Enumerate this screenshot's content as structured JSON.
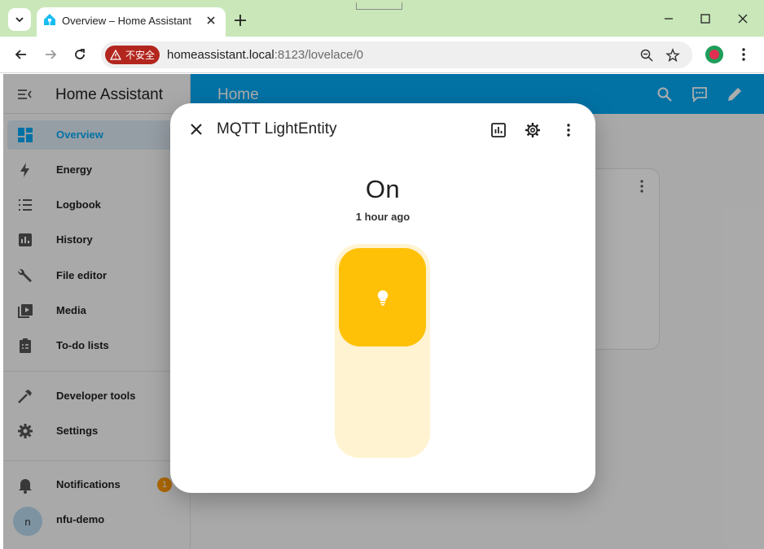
{
  "browser": {
    "tab_title": "Overview – Home Assistant",
    "security_label": "不安全",
    "url_host": "homeassistant.local",
    "url_rest": ":8123/lovelace/0"
  },
  "sidebar": {
    "title": "Home Assistant",
    "items": [
      {
        "label": "Overview",
        "icon": "dashboard-icon",
        "active": true
      },
      {
        "label": "Energy",
        "icon": "lightning-bolt-icon"
      },
      {
        "label": "Logbook",
        "icon": "list-icon"
      },
      {
        "label": "History",
        "icon": "chart-box-icon"
      },
      {
        "label": "File editor",
        "icon": "wrench-icon"
      },
      {
        "label": "Media",
        "icon": "play-box-icon"
      },
      {
        "label": "To-do lists",
        "icon": "clipboard-list-icon"
      },
      {
        "label": "Developer tools",
        "icon": "hammer-icon"
      },
      {
        "label": "Settings",
        "icon": "gear-icon"
      }
    ],
    "notifications": {
      "label": "Notifications",
      "count": "1",
      "icon": "bell-icon"
    },
    "user": {
      "name": "nfu-demo",
      "initial": "n"
    }
  },
  "main": {
    "title": "Home"
  },
  "dialog": {
    "title": "MQTT LightEntity",
    "state": "On",
    "last_changed": "1 hour ago",
    "brightness_fraction": 0.48,
    "accent_color": "#ffc107"
  },
  "colors": {
    "ha_primary": "#03a9f4",
    "insecure_chip": "#b3261e",
    "tab_strip": "#c9e7b9"
  }
}
